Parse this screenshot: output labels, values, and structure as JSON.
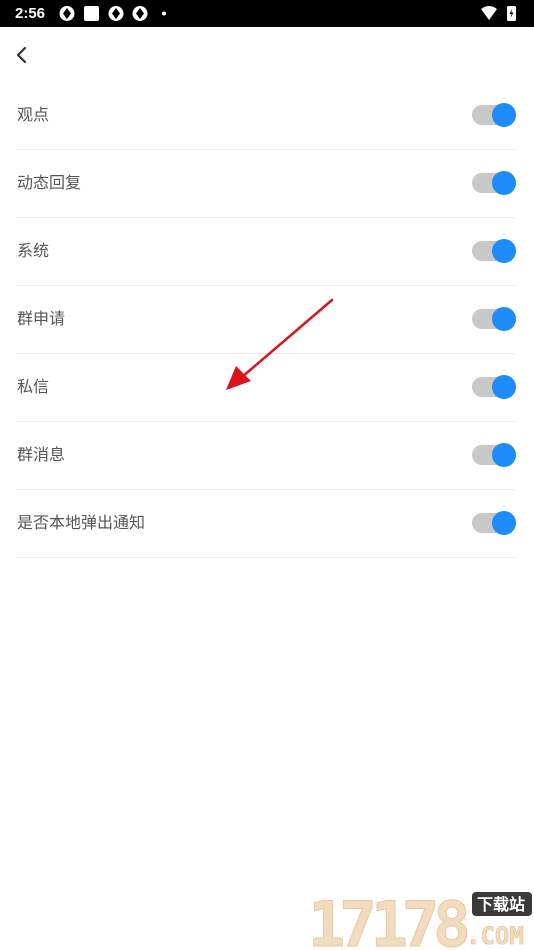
{
  "status_bar": {
    "time": "2:56"
  },
  "settings": [
    {
      "label": "观点"
    },
    {
      "label": "动态回复"
    },
    {
      "label": "系统"
    },
    {
      "label": "群申请"
    },
    {
      "label": "私信"
    },
    {
      "label": "群消息"
    },
    {
      "label": "是否本地弹出通知"
    }
  ],
  "watermark": {
    "number": "17178",
    "badge": "下载站",
    "suffix": ".COM"
  },
  "colors": {
    "toggle_on": "#1d8bf8",
    "toggle_track": "#c8c8c8",
    "arrow": "#d9141b"
  }
}
